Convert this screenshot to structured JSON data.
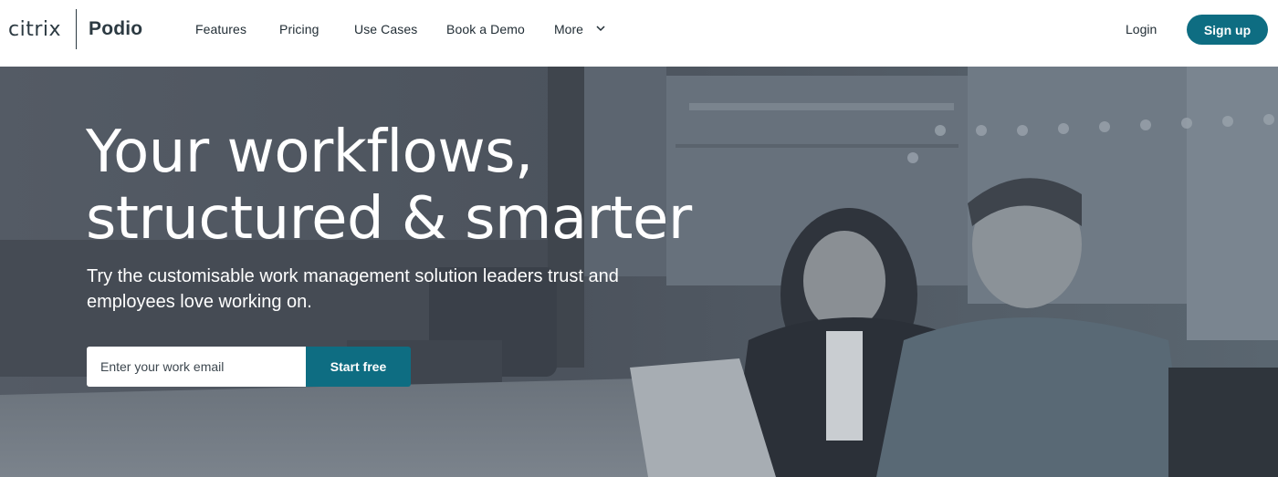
{
  "brand": {
    "company": "citrix",
    "product": "Podio"
  },
  "nav": {
    "items": [
      {
        "label": "Features"
      },
      {
        "label": "Pricing"
      },
      {
        "label": "Use Cases"
      },
      {
        "label": "Book a Demo"
      }
    ],
    "more_label": "More",
    "more_icon": "chevron-down-icon"
  },
  "auth": {
    "login_label": "Login",
    "signup_label": "Sign up"
  },
  "hero": {
    "title_line1": "Your workflows,",
    "title_line2": "structured & smarter",
    "subtitle": "Try the customisable work management solution leaders trust and employees love working on.",
    "email_placeholder": "Enter your work email",
    "email_value": "",
    "cta_label": "Start free"
  },
  "colors": {
    "accent": "#0e6d82",
    "hero_overlay": "#4d545e",
    "text_dark": "#1f2b33"
  }
}
